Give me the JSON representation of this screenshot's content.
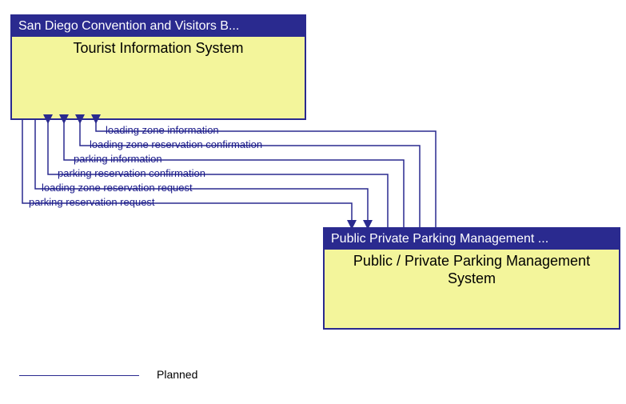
{
  "top_box": {
    "header": "San Diego Convention and Visitors B...",
    "title": "Tourist Information System"
  },
  "bottom_box": {
    "header": "Public Private Parking Management ...",
    "title": "Public / Private Parking Management System"
  },
  "flows": {
    "f1": "loading zone information",
    "f2": "loading zone reservation confirmation",
    "f3": "parking information",
    "f4": "parking reservation confirmation",
    "f5": "loading zone reservation request",
    "f6": "parking reservation request"
  },
  "legend": {
    "planned": "Planned"
  }
}
